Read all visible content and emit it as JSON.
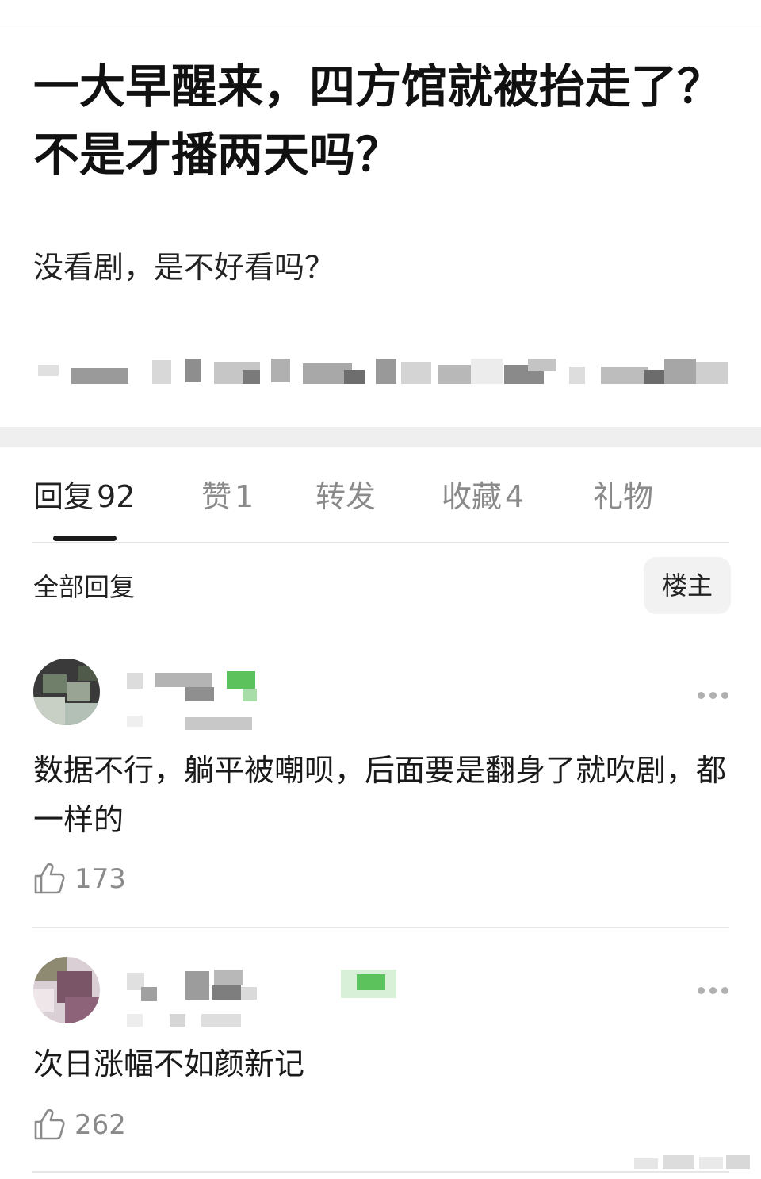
{
  "post": {
    "title": "一大早醒来，四方馆就被抬走了？不是才播两天吗？",
    "body": "没看剧，是不好看吗？"
  },
  "tabs": [
    {
      "label": "回复",
      "count": "92"
    },
    {
      "label": "赞",
      "count": "1"
    },
    {
      "label": "转发",
      "count": ""
    },
    {
      "label": "收藏",
      "count": "4"
    },
    {
      "label": "礼物",
      "count": ""
    }
  ],
  "filter": {
    "all_replies_label": "全部回复",
    "op_only_label": "楼主"
  },
  "comments": [
    {
      "text": "数据不行，躺平被嘲呗，后面要是翻身了就吹剧，都一样的",
      "likes": "173"
    },
    {
      "text": "次日涨幅不如颜新记",
      "likes": "262"
    }
  ],
  "icons": {
    "like": "thumbs-up-icon",
    "more": "more-dots-icon"
  },
  "colors": {
    "muted_text": "#8a8a8a",
    "badge_green": "#5cc25c",
    "divider": "#e6e6e6"
  }
}
